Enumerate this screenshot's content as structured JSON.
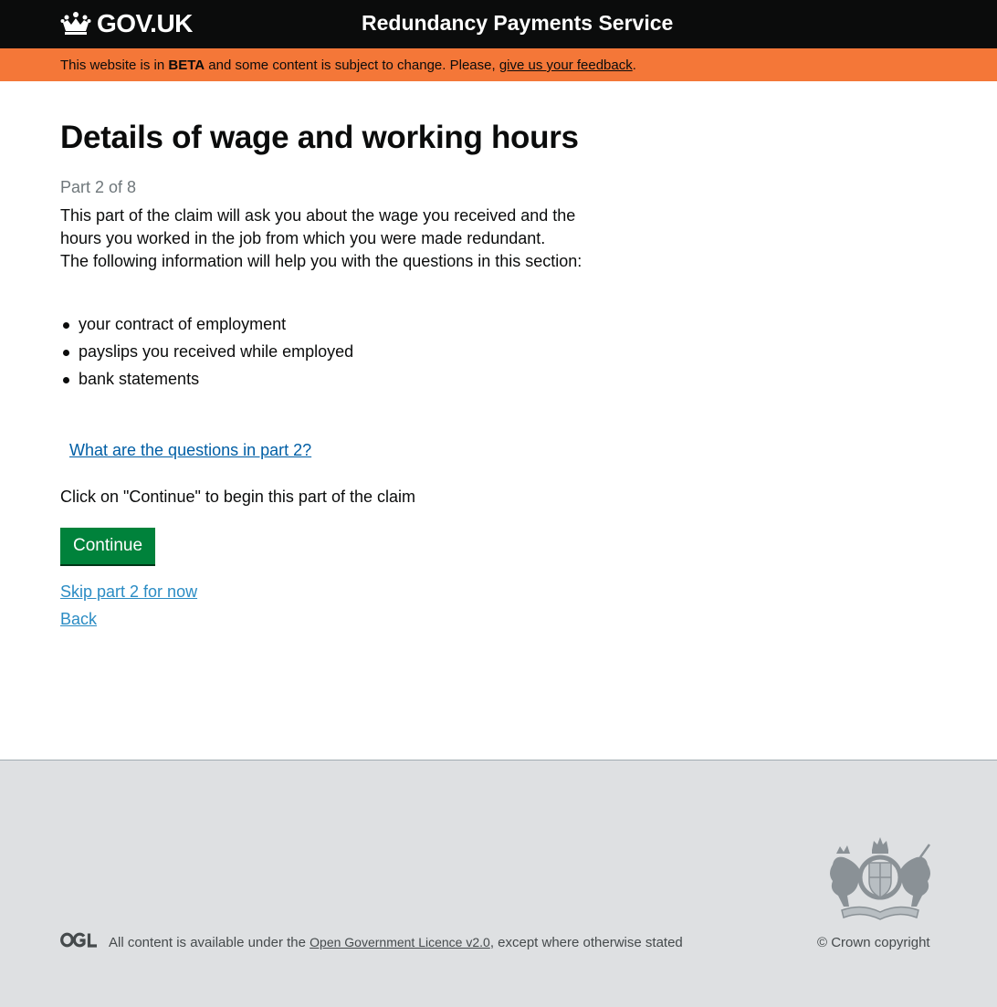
{
  "header": {
    "logo_text": "GOV.UK",
    "service_name": "Redundancy Payments Service"
  },
  "beta_banner": {
    "prefix": "This website is in ",
    "tag": "BETA",
    "middle": " and some content is subject to change. Please, ",
    "link": "give us your feedback",
    "suffix": "."
  },
  "main": {
    "title": "Details of wage and working hours",
    "caption": "Part 2 of 8",
    "intro_1": "This part of the claim will ask you about the wage you received and the hours you worked in the job from which you were made redundant.",
    "intro_2": "The following information will help you with the questions in this section:",
    "bullets": [
      "your contract of employment",
      "payslips you received while employed",
      "bank statements"
    ],
    "questions_link": "What are the questions in part 2?",
    "click_text": "Click on \"Continue\" to begin this part of the claim",
    "continue_label": "Continue",
    "skip_link": "Skip part 2 for now",
    "back_link": "Back"
  },
  "footer": {
    "ogl": "OGL",
    "licence_prefix": "All content is available under the ",
    "licence_link": "Open Government Licence v2.0",
    "licence_suffix": ", except where otherwise stated",
    "copyright": "© Crown copyright"
  },
  "colors": {
    "header_bg": "#0b0c0c",
    "beta_bg": "#f47738",
    "continue_bg": "#00823b",
    "link": "#2b8cc4",
    "footer_bg": "#dee0e2"
  }
}
